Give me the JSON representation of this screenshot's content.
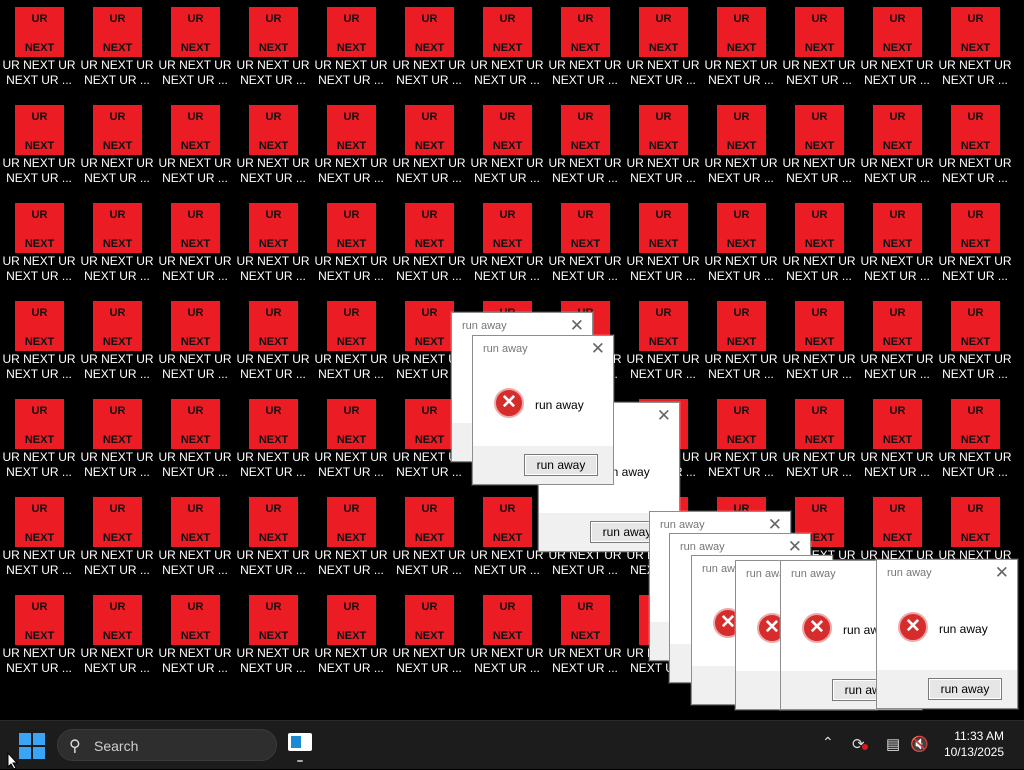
{
  "desktop": {
    "icon_image_text_top": "UR",
    "icon_image_text_bottom": "NEXT",
    "icon_label_line1": "UR NEXT UR",
    "icon_label_line2": "NEXT UR ...",
    "columns": 13,
    "rows": 7,
    "icon_color": "#ec1c24"
  },
  "dialogs": [
    {
      "title": "run away",
      "message": "run away",
      "button": "run away"
    },
    {
      "title": "run away",
      "message": "run away",
      "button": "run away"
    },
    {
      "title": "run away",
      "message": "run away",
      "button": "run away"
    },
    {
      "title": "run away",
      "message": "run away",
      "button": "run away"
    },
    {
      "title": "run away",
      "message": "run away",
      "button": "run away"
    },
    {
      "title": "run away",
      "message": "run away",
      "button": "run away"
    },
    {
      "title": "run away",
      "message": "run away",
      "button": "run away"
    },
    {
      "title": "run away",
      "message": "run away",
      "button": "run away"
    },
    {
      "title": "run away",
      "message": "run away",
      "button": "run away"
    }
  ],
  "taskbar": {
    "search_placeholder": "Search",
    "time": "11:33 AM",
    "date": "10/13/2025",
    "icons": [
      "start-icon",
      "search-icon",
      "app-window-icon",
      "chevron-up-icon",
      "sync-icon",
      "network-icon",
      "volume-muted-icon"
    ]
  }
}
